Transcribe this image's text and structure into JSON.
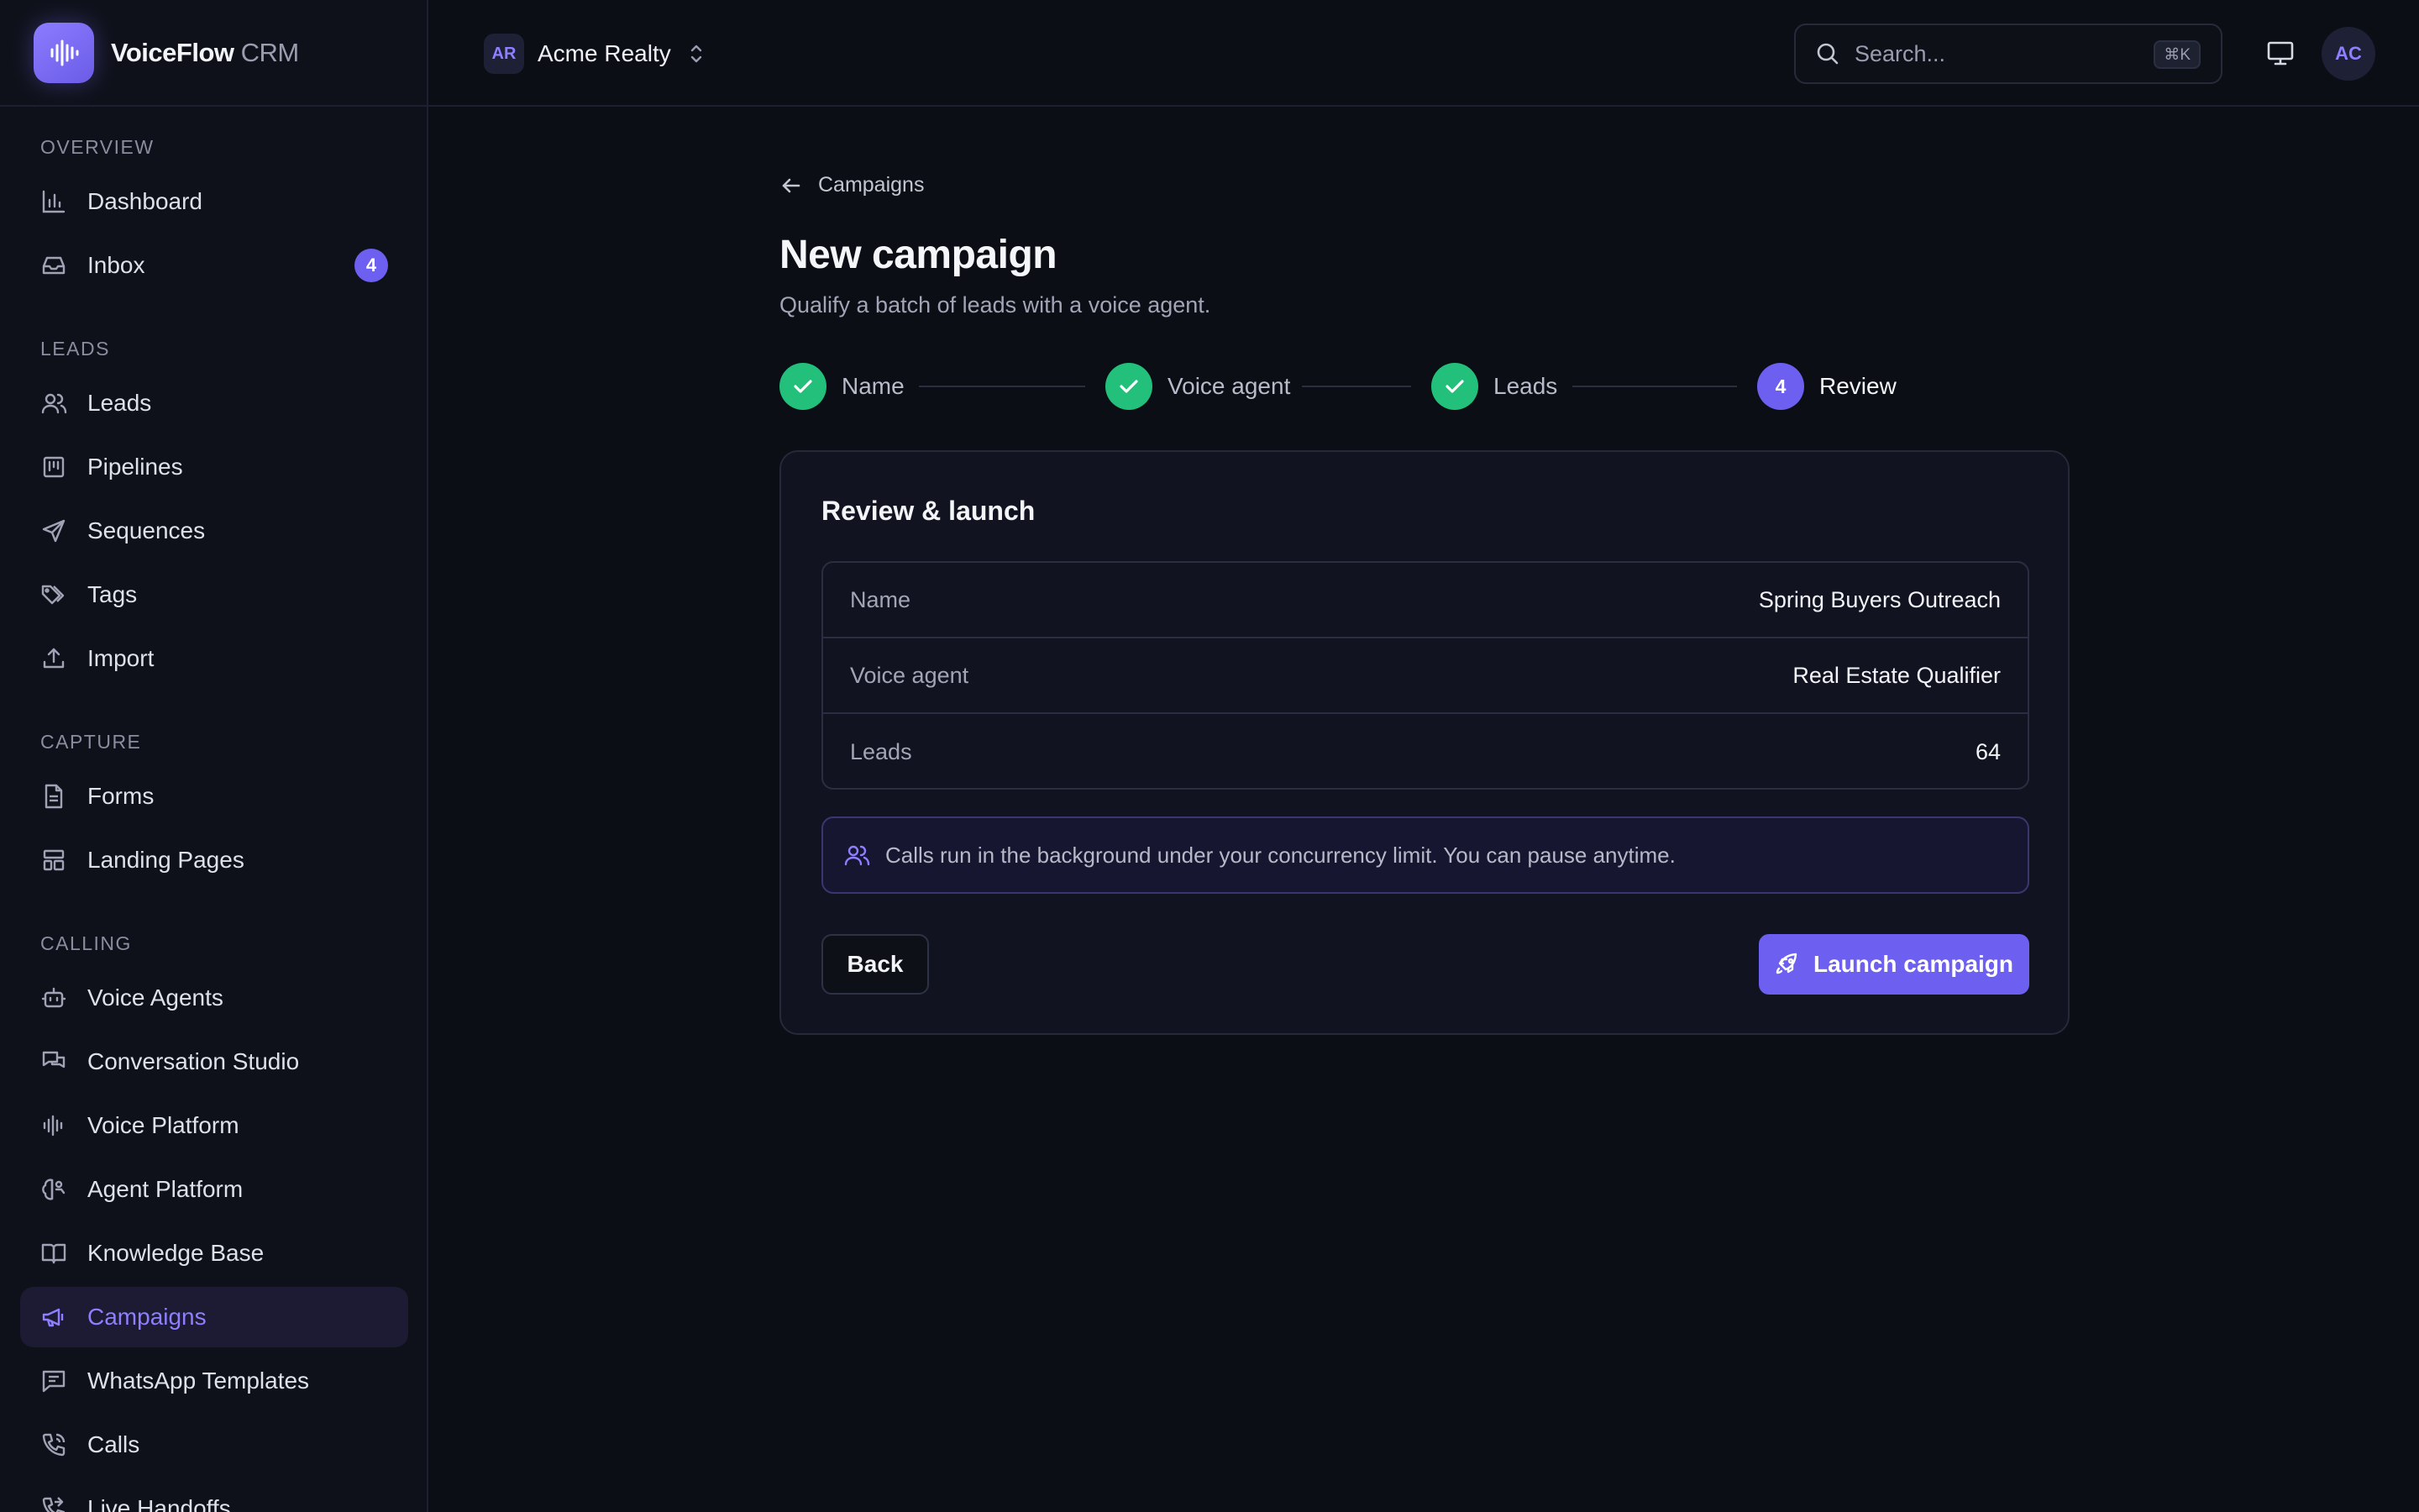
{
  "brand": {
    "name": "VoiceFlow",
    "suffix": "CRM"
  },
  "org": {
    "initials": "AR",
    "name": "Acme Realty"
  },
  "search": {
    "placeholder": "Search...",
    "shortcut": "⌘K"
  },
  "user": {
    "initials": "AC"
  },
  "sidebar": {
    "sections": {
      "overview": "OVERVIEW",
      "leads": "LEADS",
      "capture": "CAPTURE",
      "calling": "CALLING"
    },
    "items": {
      "dashboard": "Dashboard",
      "inbox": "Inbox",
      "inbox_badge": "4",
      "leads": "Leads",
      "pipelines": "Pipelines",
      "sequences": "Sequences",
      "tags": "Tags",
      "import": "Import",
      "forms": "Forms",
      "landing_pages": "Landing Pages",
      "voice_agents": "Voice Agents",
      "conversation_studio": "Conversation Studio",
      "voice_platform": "Voice Platform",
      "agent_platform": "Agent Platform",
      "knowledge_base": "Knowledge Base",
      "campaigns": "Campaigns",
      "whatsapp_templates": "WhatsApp Templates",
      "calls": "Calls",
      "live_handoffs": "Live Handoffs"
    },
    "active_item": "Campaigns"
  },
  "page": {
    "breadcrumb": "Campaigns",
    "title": "New campaign",
    "subtitle": "Qualify a batch of leads with a voice agent."
  },
  "stepper": {
    "steps": [
      {
        "label": "Name",
        "status": "done"
      },
      {
        "label": "Voice agent",
        "status": "done"
      },
      {
        "label": "Leads",
        "status": "done"
      },
      {
        "label": "Review",
        "status": "current",
        "number": "4"
      }
    ]
  },
  "review": {
    "title": "Review & launch",
    "rows": [
      {
        "key": "Name",
        "value": "Spring Buyers Outreach"
      },
      {
        "key": "Voice agent",
        "value": "Real Estate Qualifier"
      },
      {
        "key": "Leads",
        "value": "64"
      }
    ],
    "notice": "Calls run in the background under your concurrency limit. You can pause anytime.",
    "back_label": "Back",
    "launch_label": "Launch campaign"
  },
  "colors": {
    "accent": "#6d5ff0",
    "success": "#22c07a",
    "background": "#0c0e15"
  }
}
